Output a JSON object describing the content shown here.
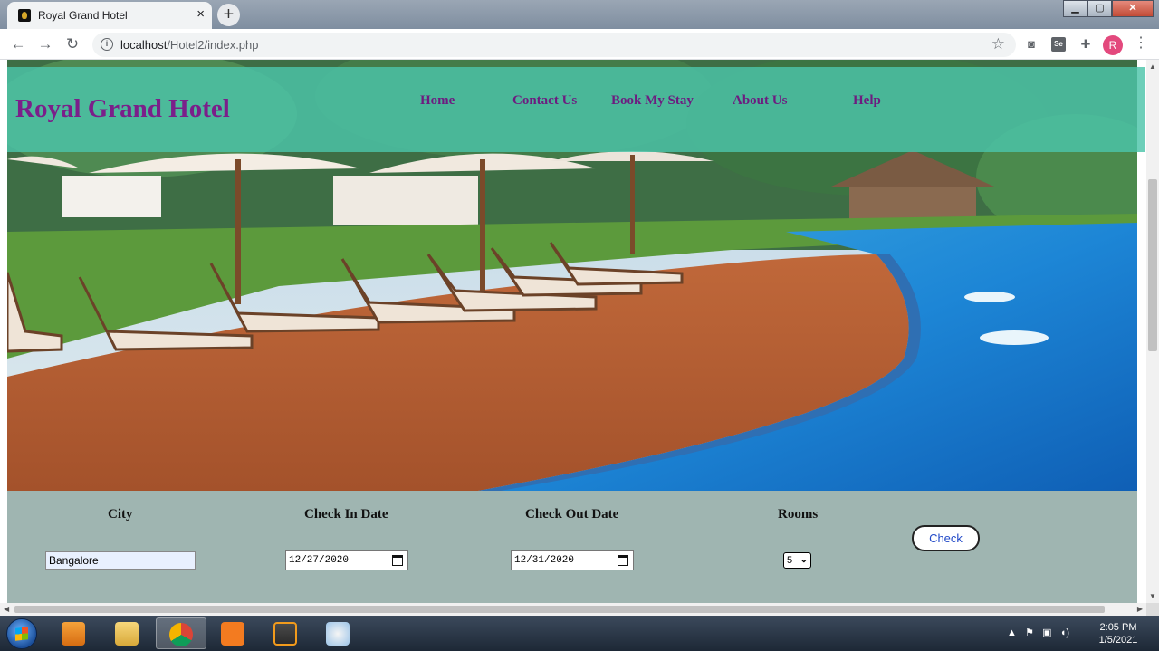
{
  "browser": {
    "tab_title": "Royal Grand Hotel",
    "tab_close": "×",
    "new_tab": "+",
    "url_host": "localhost",
    "url_path": "/Hotel2/index.php",
    "profile_initial": "R",
    "window_buttons": {
      "minimize": "▁",
      "maximize": "▢",
      "close": "✕"
    }
  },
  "site": {
    "brand": "Royal Grand Hotel",
    "nav": [
      "Home",
      "Contact Us",
      "Book My Stay",
      "About Us",
      "Help"
    ]
  },
  "search": {
    "city_label": "City",
    "city_value": "Bangalore",
    "checkin_label": "Check In Date",
    "checkin_value": "12/27/2020",
    "checkout_label": "Check Out Date",
    "checkout_value": "12/31/2020",
    "rooms_label": "Rooms",
    "rooms_value": "5",
    "check_button": "Check"
  },
  "taskbar": {
    "time": "2:05 PM",
    "date": "1/5/2021"
  },
  "colors": {
    "header_overlay": "#4cc4aa",
    "brand_purple": "#7b1f8a",
    "search_bg": "#9fb5b1",
    "button_text": "#2149c8"
  }
}
